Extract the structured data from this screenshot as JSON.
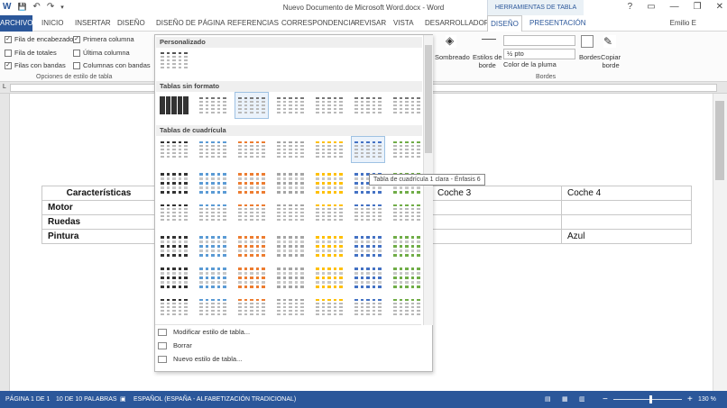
{
  "title": "Nuevo Documento de Microsoft Word.docx - Word",
  "context_group": "HERRAMIENTAS DE TABLA",
  "window_controls": [
    "?",
    "▭",
    "—",
    "❐",
    "✕"
  ],
  "quick_access": [
    "W",
    "💾",
    "↶",
    "↷",
    "▾"
  ],
  "tabs": [
    "ARCHIVO",
    "INICIO",
    "INSERTAR",
    "DISEÑO",
    "DISEÑO DE PÁGINA",
    "REFERENCIAS",
    "CORRESPONDENCIA",
    "REVISAR",
    "VISTA",
    "DESARROLLADOR",
    "DISEÑO",
    "PRESENTACIÓN"
  ],
  "user": "Emilio E",
  "ribbon": {
    "options": [
      {
        "label": "Fila de encabezado",
        "checked": true
      },
      {
        "label": "Primera columna",
        "checked": true
      },
      {
        "label": "Fila de totales",
        "checked": false
      },
      {
        "label": "Última columna",
        "checked": false
      },
      {
        "label": "Filas con bandas",
        "checked": true
      },
      {
        "label": "Columnas con bandas",
        "checked": false
      }
    ],
    "options_group_label": "Opciones de estilo de tabla",
    "sombreado": "Sombreado",
    "estilos_de": "Estilos de",
    "borde": "borde",
    "pen_weight": "½ pto",
    "pen_color": "Color de la pluma",
    "bordes": "Bordes",
    "copiar": "Copiar",
    "formato_borde": "borde",
    "bordes_group_label": "Bordes"
  },
  "gallery": {
    "sections": [
      "Personalizado",
      "Tablas sin formato",
      "Tablas de cuadrícula"
    ],
    "tooltip": "Tabla de cuadrícula 1 clara - Énfasis 6",
    "menu": [
      "Modificar estilo de tabla...",
      "Borrar",
      "Nuevo estilo de tabla..."
    ],
    "accents": [
      "#333333",
      "#5b9bd5",
      "#ed7d31",
      "#a5a5a5",
      "#ffc000",
      "#4472c4",
      "#70ad47"
    ]
  },
  "document_table": {
    "header": [
      "Características",
      "",
      "",
      "Coche 3",
      "Coche 4"
    ],
    "rows": [
      [
        "Motor",
        "",
        "",
        "",
        ""
      ],
      [
        "Ruedas",
        "",
        "",
        "",
        ""
      ],
      [
        "Pintura",
        "",
        "",
        "",
        "Azul"
      ]
    ]
  },
  "status": {
    "page": "PÁGINA 1 DE 1",
    "words": "10 DE 10 PALABRAS",
    "language": "ESPAÑOL (ESPAÑA - ALFABETIZACIÓN TRADICIONAL)",
    "zoom": "130 %",
    "zoom_fraction": 0.53
  }
}
